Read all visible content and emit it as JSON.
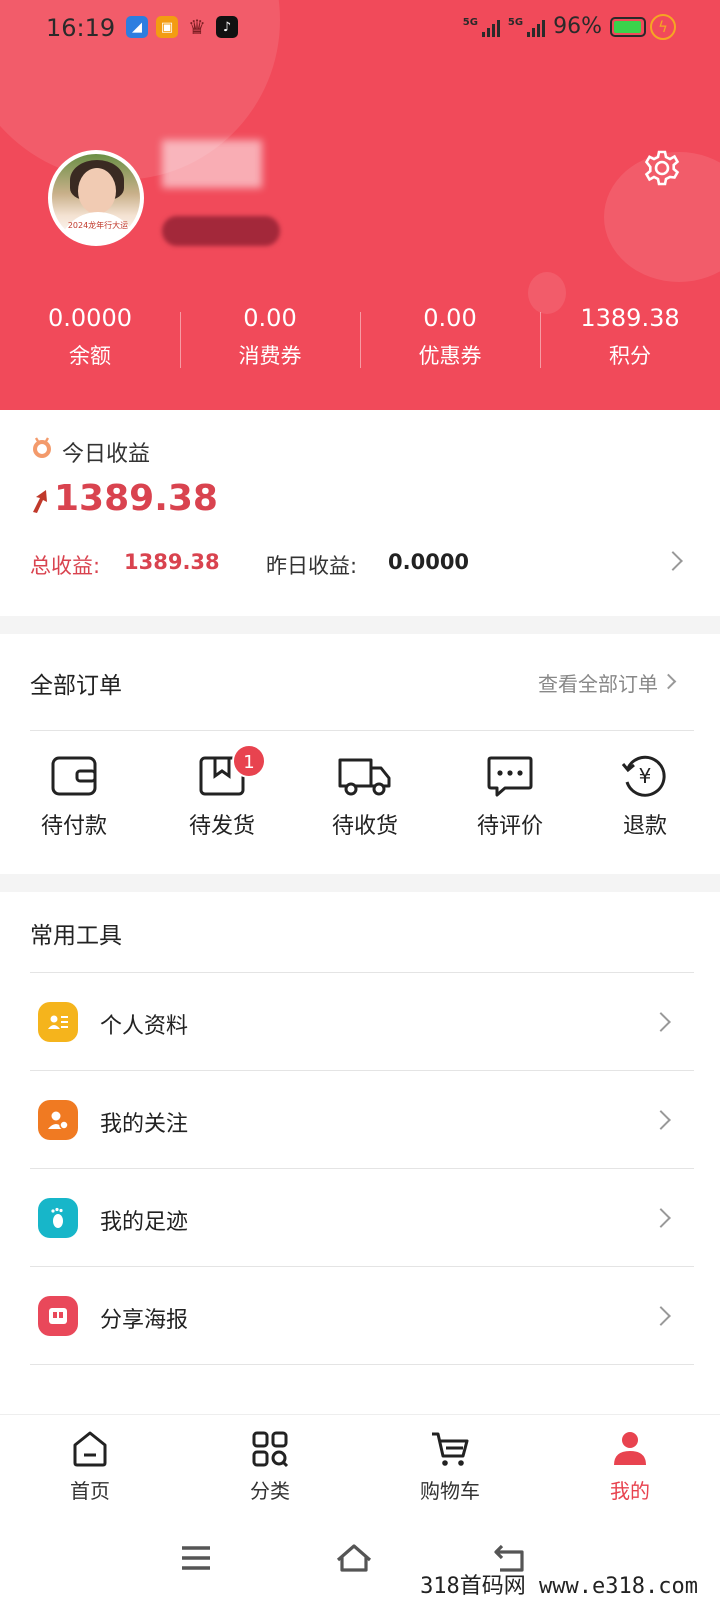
{
  "status_bar": {
    "time": "16:19",
    "signal1": "5G",
    "signal2": "5G",
    "battery": "96%",
    "battery_level": 0.96
  },
  "profile": {
    "avatar_caption": "2024龙年行大运"
  },
  "stats": [
    {
      "value": "0.0000",
      "label": "余额"
    },
    {
      "value": "0.00",
      "label": "消费券"
    },
    {
      "value": "0.00",
      "label": "优惠券"
    },
    {
      "value": "1389.38",
      "label": "积分"
    }
  ],
  "earnings": {
    "title": "今日收益",
    "today": "1389.38",
    "total_label": "总收益:",
    "total_value": "1389.38",
    "yesterday_label": "昨日收益:",
    "yesterday_value": "0.0000"
  },
  "orders": {
    "title": "全部订单",
    "view_all": "查看全部订单",
    "items": [
      {
        "label": "待付款",
        "icon": "wallet-icon"
      },
      {
        "label": "待发货",
        "icon": "box-icon",
        "badge": "1"
      },
      {
        "label": "待收货",
        "icon": "truck-icon"
      },
      {
        "label": "待评价",
        "icon": "comment-icon"
      },
      {
        "label": "退款",
        "icon": "refund-icon"
      }
    ]
  },
  "tools": {
    "title": "常用工具",
    "items": [
      {
        "label": "个人资料",
        "icon": "profile-card-icon",
        "color": "#f5b41c"
      },
      {
        "label": "我的关注",
        "icon": "user-follow-icon",
        "color": "#f07a22"
      },
      {
        "label": "我的足迹",
        "icon": "footprint-icon",
        "color": "#17b6c9"
      },
      {
        "label": "分享海报",
        "icon": "poster-icon",
        "color": "#e9485a"
      }
    ]
  },
  "tabbar": [
    {
      "label": "首页",
      "icon": "home-icon"
    },
    {
      "label": "分类",
      "icon": "category-icon"
    },
    {
      "label": "购物车",
      "icon": "cart-icon"
    },
    {
      "label": "我的",
      "icon": "user-icon",
      "active": true
    }
  ],
  "watermark": "318首码网  www.e318.com",
  "colors": {
    "brand": "#f14a5a",
    "accent": "#e8434f"
  }
}
